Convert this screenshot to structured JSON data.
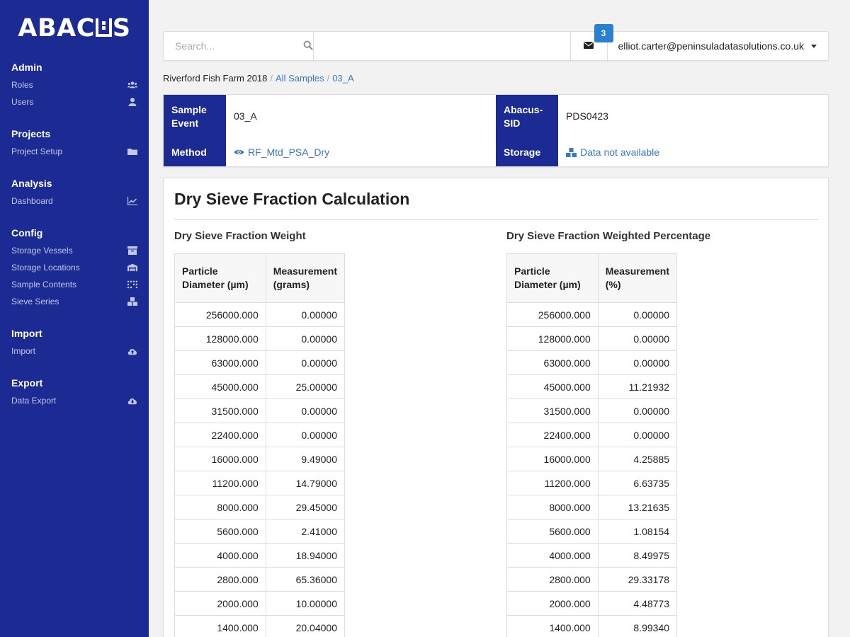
{
  "app": {
    "logo": "ABACUS"
  },
  "sidebar": {
    "sections": [
      {
        "heading": "Admin",
        "items": [
          {
            "label": "Roles",
            "icon": "users-icon"
          },
          {
            "label": "Users",
            "icon": "user-icon"
          }
        ]
      },
      {
        "heading": "Projects",
        "items": [
          {
            "label": "Project Setup",
            "icon": "folder-icon"
          }
        ]
      },
      {
        "heading": "Analysis",
        "items": [
          {
            "label": "Dashboard",
            "icon": "line-chart-icon"
          }
        ]
      },
      {
        "heading": "Config",
        "items": [
          {
            "label": "Storage Vessels",
            "icon": "archive-icon"
          },
          {
            "label": "Storage Locations",
            "icon": "warehouse-icon"
          },
          {
            "label": "Sample Contents",
            "icon": "grid-icon"
          },
          {
            "label": "Sieve Series",
            "icon": "cubes-icon"
          }
        ]
      },
      {
        "heading": "Import",
        "items": [
          {
            "label": "Import",
            "icon": "cloud-upload-icon"
          }
        ]
      },
      {
        "heading": "Export",
        "items": [
          {
            "label": "Data Export",
            "icon": "cloud-download-icon"
          }
        ]
      }
    ]
  },
  "topbar": {
    "search_placeholder": "Search...",
    "mail_badge": "3",
    "user_email": "elliot.carter@peninsuladatasolutions.co.uk"
  },
  "breadcrumb": {
    "project": "Riverford Fish Farm 2018",
    "all_samples": "All Samples",
    "sample": "03_A"
  },
  "info": {
    "sample_event_label": "Sample Event",
    "sample_event_value": "03_A",
    "method_label": "Method",
    "method_value": "RF_Mtd_PSA_Dry",
    "abacus_sid_label": "Abacus-SID",
    "abacus_sid_value": "PDS0423",
    "storage_label": "Storage",
    "storage_value": "Data not available"
  },
  "panel": {
    "title": "Dry Sieve Fraction Calculation",
    "weight_title": "Dry Sieve Fraction Weight",
    "percent_title": "Dry Sieve Fraction Weighted Percentage",
    "weight_table": {
      "headers": [
        "Particle Diameter (µm)",
        "Measurement (grams)"
      ],
      "rows": [
        [
          "256000.000",
          "0.00000"
        ],
        [
          "128000.000",
          "0.00000"
        ],
        [
          "63000.000",
          "0.00000"
        ],
        [
          "45000.000",
          "25.00000"
        ],
        [
          "31500.000",
          "0.00000"
        ],
        [
          "22400.000",
          "0.00000"
        ],
        [
          "16000.000",
          "9.49000"
        ],
        [
          "11200.000",
          "14.79000"
        ],
        [
          "8000.000",
          "29.45000"
        ],
        [
          "5600.000",
          "2.41000"
        ],
        [
          "4000.000",
          "18.94000"
        ],
        [
          "2800.000",
          "65.36000"
        ],
        [
          "2000.000",
          "10.00000"
        ],
        [
          "1400.000",
          "20.04000"
        ]
      ]
    },
    "percent_table": {
      "headers": [
        "Particle Diameter (µm)",
        "Measurement (%)"
      ],
      "rows": [
        [
          "256000.000",
          "0.00000"
        ],
        [
          "128000.000",
          "0.00000"
        ],
        [
          "63000.000",
          "0.00000"
        ],
        [
          "45000.000",
          "11.21932"
        ],
        [
          "31500.000",
          "0.00000"
        ],
        [
          "22400.000",
          "0.00000"
        ],
        [
          "16000.000",
          "4.25885"
        ],
        [
          "11200.000",
          "6.63735"
        ],
        [
          "8000.000",
          "13.21635"
        ],
        [
          "5600.000",
          "1.08154"
        ],
        [
          "4000.000",
          "8.49975"
        ],
        [
          "2800.000",
          "29.33178"
        ],
        [
          "2000.000",
          "4.48773"
        ],
        [
          "1400.000",
          "8.99340"
        ]
      ]
    }
  },
  "colors": {
    "sidebar_bg": "#1c2a93",
    "link": "#3a78c4",
    "badge": "#2a7fcf"
  }
}
